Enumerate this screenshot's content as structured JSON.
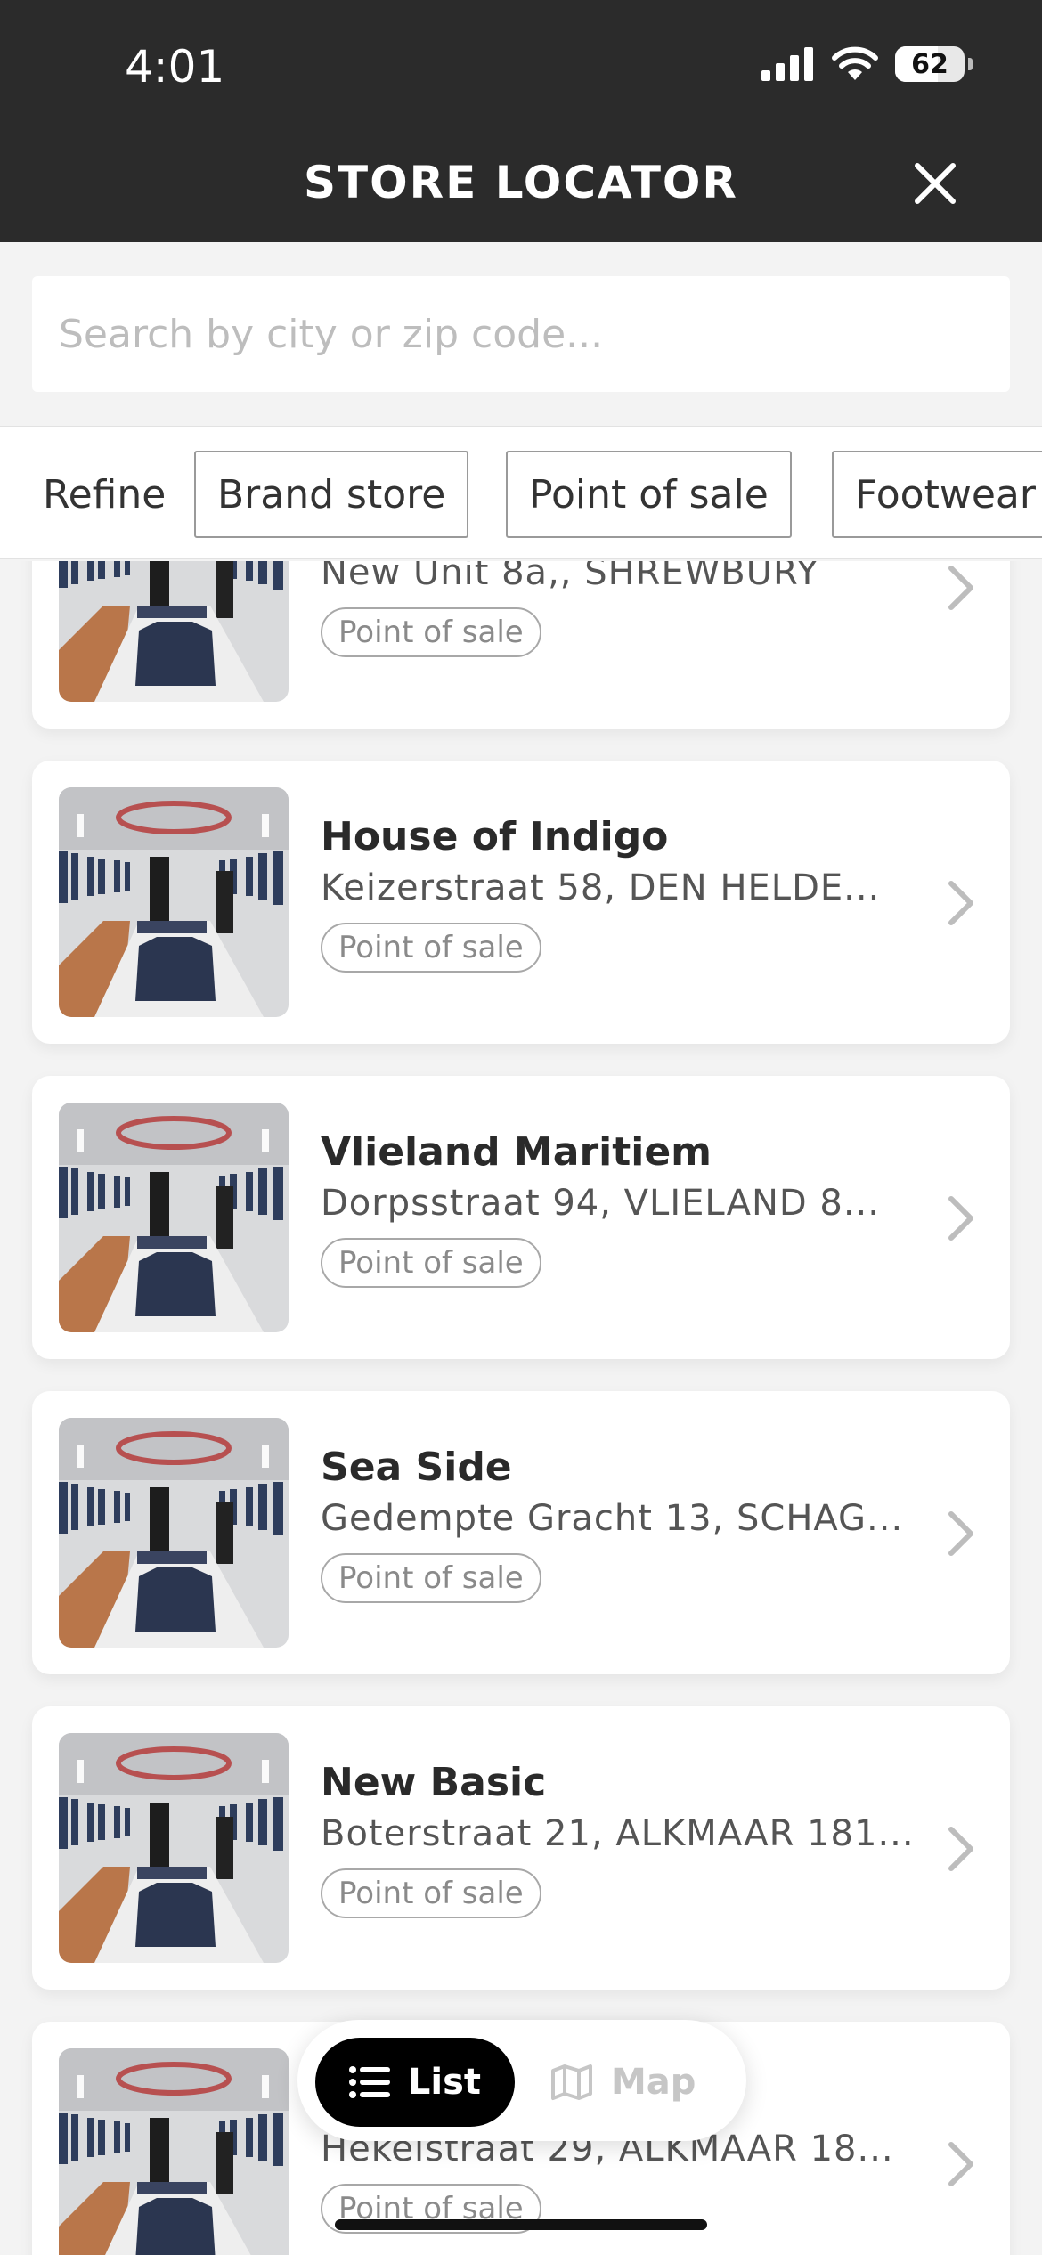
{
  "status_bar": {
    "time": "4:01",
    "battery": "62",
    "battery_level": 0.62
  },
  "header": {
    "title": "STORE LOCATOR",
    "close_icon": "close-icon"
  },
  "search": {
    "value": "",
    "placeholder": "Search by city or zip code..."
  },
  "filters": {
    "refine_label": "Refine",
    "chips": [
      "Brand store",
      "Point of sale",
      "Footwear"
    ]
  },
  "stores": [
    {
      "name": "",
      "address": "New Unit 8a,, SHREWBURY",
      "tag": "Point of sale"
    },
    {
      "name": "House of Indigo",
      "address": "Keizerstraat 58, DEN HELDE...",
      "tag": "Point of sale"
    },
    {
      "name": "Vlieland Maritiem",
      "address": "Dorpsstraat 94, VLIELAND 8...",
      "tag": "Point of sale"
    },
    {
      "name": "Sea Side",
      "address": "Gedempte Gracht 13, SCHAG...",
      "tag": "Point of sale"
    },
    {
      "name": "New Basic",
      "address": "Boterstraat 21, ALKMAAR 181...",
      "tag": "Point of sale"
    },
    {
      "name": "",
      "address": "Hekelstraat 29, ALKMAAR 18...",
      "tag": "Point of sale"
    }
  ],
  "view_toggle": {
    "list_label": "List",
    "map_label": "Map",
    "active": "List"
  },
  "colors": {
    "header_bg": "#2b2b2b",
    "page_bg": "#f3f3f3",
    "toggle_active": "#000000"
  }
}
